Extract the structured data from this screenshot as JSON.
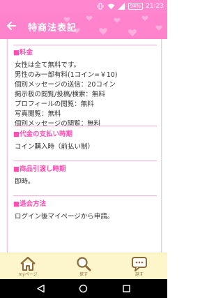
{
  "status_bar": {
    "battery": "94%",
    "time": "21:23"
  },
  "app_bar": {
    "title": "特商法表記"
  },
  "sections": [
    {
      "title": "■料金",
      "lines": [
        "女性は全て無料です。",
        "男性のみ一部有料(1コイン=￥10)",
        "個別メッセージの送信：20コイン",
        "掲示板の閲覧/投稿/検索：無料",
        "プロフィールの閲覧：無料",
        "写真閲覧：無料",
        "個別メッセージの閲覧：無料"
      ]
    },
    {
      "title": "■代金の支払い時期",
      "lines": [
        "コイン購入時（前払い制）"
      ]
    },
    {
      "title": "■商品引渡し時期",
      "lines": [
        "即時。"
      ]
    },
    {
      "title": "■退会方法",
      "lines": [
        "ログイン後マイページから申請。"
      ]
    }
  ],
  "bottom_nav": {
    "items": [
      {
        "label": "myページ",
        "icon": "home-icon"
      },
      {
        "label": "探す",
        "icon": "search-icon"
      },
      {
        "label": "話す",
        "icon": "chat-icon"
      }
    ]
  },
  "colors": {
    "accent_pink": "#ff82cc",
    "heading_pink": "#ff4fb1",
    "nav_bg": "#fdf6cb"
  }
}
